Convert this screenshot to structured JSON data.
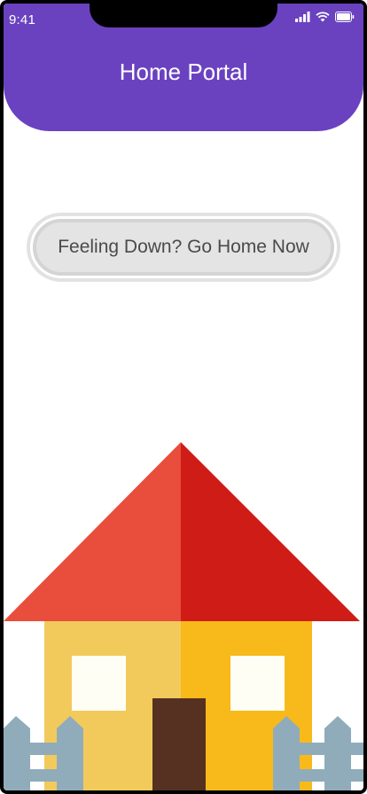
{
  "status_bar": {
    "time": "9:41",
    "icons": [
      "cellular-signal-icon",
      "wifi-icon",
      "battery-icon"
    ]
  },
  "header": {
    "title": "Home Portal",
    "color": "#6a42c0"
  },
  "cta": {
    "label": "Feeling Down? Go Home Now"
  },
  "illustration": {
    "subject": "house-with-fence",
    "colors": {
      "roof_left": "#e94d3c",
      "roof_right": "#cf1c16",
      "wall_left": "#f2ca5c",
      "wall_right": "#f8ba1a",
      "window": "#fffef4",
      "door": "#563020",
      "fence": "#90acbb"
    }
  }
}
